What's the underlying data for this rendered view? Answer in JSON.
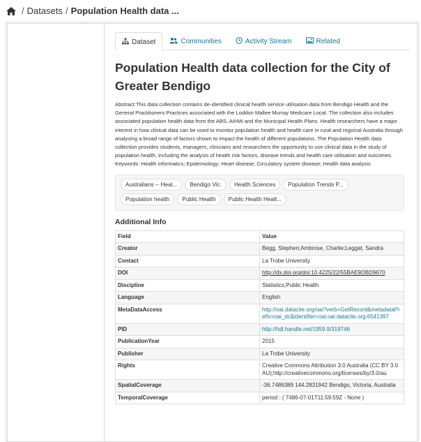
{
  "breadcrumb": {
    "icon": "home-icon",
    "separator": "/",
    "datasets": "Datasets",
    "current": "Population Health data ..."
  },
  "tabs": [
    {
      "label": "Dataset",
      "icon": "sitemap-icon",
      "active": true
    },
    {
      "label": "Communities",
      "icon": "users-icon",
      "active": false
    },
    {
      "label": "Activity Stream",
      "icon": "clock-icon",
      "active": false
    },
    {
      "label": "Related",
      "icon": "picture-icon",
      "active": false
    }
  ],
  "dataset": {
    "title": "Population Health data collection for the City of Greater Bendigo",
    "abstract": "Abstract:This data collection contains de-identified clinical health service utilisation data from Bendigo Health and the General Practitioners Practices associated with the Loddon Mallee Murray Medicare Local. The collection also includes associated population health data from the ABS, AIHW and the Municipal Health Plans. Health researchers have a major interest in how clinical data can be used to monitor population health and health care in rural and regional Australia through analysing a broad range of factors shown to impact the health of different populations. The Population Health data collection provides students, managers, clinicians and researchers the opportunity to use clinical data in the study of population health, including the analysis of health risk factors, disease trends and health care utilisation and outcomes. Keywords: Health informatics; Epidemiology; Heart disease; Circulatory system disease; Health data analysis",
    "tags": [
      "Australians -- Heal...",
      "Bendigo Vic.",
      "Health Sciences",
      "Population Trends P...",
      "Population health",
      "Public Health",
      "Public Health Healt..."
    ]
  },
  "additional_info": {
    "heading": "Additional Info",
    "columns": {
      "field": "Field",
      "value": "Value"
    },
    "rows": [
      {
        "field": "Creator",
        "value": "Begg, Stephen;Ambrose, Charlie;Leggat, Sandra",
        "link": false
      },
      {
        "field": "Contact",
        "value": "La Trobe University",
        "link": false
      },
      {
        "field": "DOI",
        "value": "http://dx.doi.org/doi:10.4225/22/55BAE9DBD9670",
        "link": "underline"
      },
      {
        "field": "Discipline",
        "value": "Statistics;Public Health",
        "link": false
      },
      {
        "field": "Language",
        "value": "English",
        "link": false
      },
      {
        "field": "MetaDataAccess",
        "value": "http://oai.datacite.org/oai?verb=GetRecord&metadataPrefix=oai_dc&identifier=oai:oai.datacite.org:6541397",
        "link": true
      },
      {
        "field": "PID",
        "value": "http://hdl.handle.net/1959.9/319746",
        "link": true
      },
      {
        "field": "PublicationYear",
        "value": "2015",
        "link": false
      },
      {
        "field": "Publisher",
        "value": "La Trobe University",
        "link": false
      },
      {
        "field": "Rights",
        "value": "Creative Commons Attribution 3.0 Australia (CC BY 3.0 AU);http://creativecommons.org/licenses/by/3.0/au",
        "link": false
      },
      {
        "field": "SpatialCoverage",
        "value": "-36.7486389 144.2831942 Bendigo, Victoria, Australia",
        "link": false
      },
      {
        "field": "TemporalCoverage",
        "value": "period : ( 7486-07-01T11:59:59Z - None )",
        "link": false
      }
    ]
  }
}
